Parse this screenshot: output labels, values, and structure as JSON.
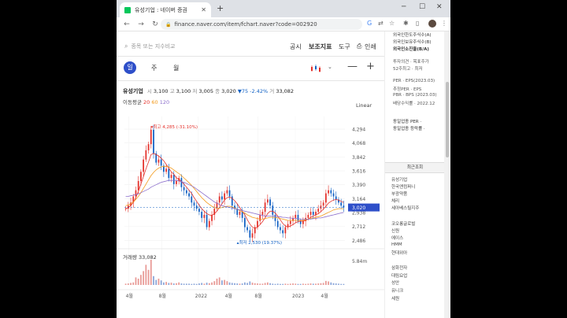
{
  "browser": {
    "tab_title": "유성기업 : 네이버 증권",
    "url": "finance.naver.com/item/fchart.naver?code=002920"
  },
  "toolbar": {
    "search_placeholder": "종목 또는 지수비교",
    "menu": [
      "공시",
      "보조지표",
      "도구",
      "인쇄"
    ]
  },
  "period_tabs": [
    "일",
    "주",
    "월"
  ],
  "quote": {
    "name": "유성기업",
    "open_label": "시",
    "open": "3,100",
    "high_label": "고",
    "high": "3,100",
    "low_label": "저",
    "low": "3,005",
    "close_label": "종",
    "close": "3,020",
    "change": "▼75 -2.42%",
    "volume_label": "거",
    "volume": "33,082"
  },
  "moving_avg": {
    "label": "이동평균",
    "periods": [
      "20",
      "60",
      "120"
    ],
    "colors": [
      "#e4312b",
      "#f39a1a",
      "#8c6fcc"
    ]
  },
  "scale_select": "Linear",
  "volume_panel": {
    "label": "거래량",
    "value": "33,082",
    "max_label": "5.84m"
  },
  "chart_data": {
    "type": "candlestick",
    "y_ticks": [
      4294,
      4068,
      3842,
      3616,
      3390,
      3164,
      2938,
      2712,
      2486
    ],
    "y_tick_labels": [
      "4,294",
      "4,068",
      "3,842",
      "3,616",
      "3,390",
      "3,164",
      "2,938",
      "2,712",
      "2,486"
    ],
    "ylim": [
      2400,
      4500
    ],
    "x_labels": [
      "4월",
      "8월",
      "2022",
      "4월",
      "8월",
      "2023",
      "4월"
    ],
    "x_positions": [
      0.02,
      0.17,
      0.335,
      0.47,
      0.605,
      0.775,
      0.905
    ],
    "current_price": 3020,
    "current_price_label": "3,020",
    "max_annotation": "최고 4,285 (-31.10%)",
    "max_price": 4285,
    "max_pos_x": 0.12,
    "min_annotation": "최저 2,530 (19.37%)",
    "min_price": 2530,
    "min_pos_x": 0.545,
    "close_series": [
      3000,
      3050,
      3100,
      3200,
      3300,
      3450,
      3600,
      3800,
      3950,
      4050,
      4285,
      3900,
      3750,
      3800,
      3700,
      3600,
      3650,
      3500,
      3550,
      3400,
      3450,
      3500,
      3350,
      3300,
      3250,
      3200,
      3100,
      3050,
      3000,
      2950,
      2850,
      2900,
      2700,
      2800,
      2900,
      3000,
      3100,
      3200,
      3150,
      3250,
      3300,
      3200,
      3050,
      3000,
      2900,
      2950,
      2850,
      2700,
      2650,
      2530,
      2600,
      2700,
      2800,
      2900,
      2950,
      3100,
      3150,
      3050,
      2900,
      2800,
      2700,
      2650,
      2600,
      2700,
      2750,
      2800,
      2850,
      2900,
      2800,
      2750,
      2800,
      2850,
      2900,
      2950,
      2900,
      2950,
      3000,
      3050,
      3100,
      3250,
      3300,
      3250,
      3200,
      3150,
      3100,
      3050,
      3020
    ],
    "ma20": [
      3000,
      3020,
      3050,
      3100,
      3180,
      3280,
      3400,
      3520,
      3650,
      3760,
      3880,
      3900,
      3880,
      3860,
      3820,
      3780,
      3720,
      3660,
      3600,
      3560,
      3500,
      3480,
      3440,
      3400,
      3350,
      3300,
      3250,
      3180,
      3120,
      3060,
      3000,
      2960,
      2920,
      2900,
      2890,
      2920,
      2960,
      3020,
      3080,
      3140,
      3180,
      3190,
      3170,
      3130,
      3080,
      3020,
      2960,
      2900,
      2820,
      2750,
      2700,
      2680,
      2700,
      2740,
      2790,
      2850,
      2920,
      2960,
      2960,
      2930,
      2880,
      2820,
      2760,
      2720,
      2700,
      2720,
      2740,
      2770,
      2790,
      2800,
      2800,
      2810,
      2830,
      2860,
      2880,
      2900,
      2920,
      2950,
      2990,
      3040,
      3090,
      3120,
      3140,
      3150,
      3140,
      3120,
      3100
    ],
    "ma60": [
      3050,
      3060,
      3080,
      3110,
      3150,
      3200,
      3260,
      3330,
      3400,
      3470,
      3540,
      3590,
      3630,
      3660,
      3680,
      3690,
      3690,
      3680,
      3660,
      3630,
      3600,
      3570,
      3540,
      3500,
      3460,
      3420,
      3380,
      3330,
      3280,
      3230,
      3180,
      3140,
      3100,
      3070,
      3040,
      3020,
      3010,
      3010,
      3020,
      3030,
      3040,
      3040,
      3030,
      3010,
      2990,
      2970,
      2950,
      2930,
      2900,
      2880,
      2860,
      2850,
      2840,
      2830,
      2830,
      2840,
      2850,
      2860,
      2860,
      2860,
      2850,
      2840,
      2830,
      2820,
      2810,
      2810,
      2810,
      2810,
      2810,
      2810,
      2810,
      2820,
      2830,
      2840,
      2850,
      2860,
      2870,
      2880,
      2900,
      2920,
      2940,
      2960,
      2980,
      2990,
      3000,
      3000,
      3000
    ],
    "ma120": [
      3200,
      3200,
      3210,
      3220,
      3230,
      3240,
      3260,
      3280,
      3300,
      3320,
      3350,
      3370,
      3390,
      3410,
      3430,
      3440,
      3450,
      3460,
      3460,
      3460,
      3460,
      3450,
      3440,
      3430,
      3410,
      3390,
      3370,
      3350,
      3320,
      3290,
      3260,
      3230,
      3200,
      3170,
      3140,
      3110,
      3090,
      3070,
      3050,
      3040,
      3030,
      3020,
      3010,
      3000,
      2990,
      2980,
      2970,
      2960,
      2950,
      2940,
      2930,
      2920,
      2910,
      2900,
      2890,
      2880,
      2880,
      2880,
      2880,
      2880,
      2870,
      2870,
      2860,
      2860,
      2850,
      2850,
      2840,
      2840,
      2840,
      2830,
      2830,
      2830,
      2830,
      2830,
      2840,
      2840,
      2850,
      2850,
      2860,
      2870,
      2880,
      2890,
      2900,
      2910,
      2920,
      2930,
      2940
    ],
    "volume_series": [
      0.05,
      0.06,
      0.08,
      0.1,
      0.3,
      0.25,
      0.4,
      0.55,
      0.8,
      0.6,
      1.0,
      0.35,
      0.2,
      0.25,
      0.18,
      0.1,
      0.12,
      0.08,
      0.09,
      0.06,
      0.07,
      0.1,
      0.06,
      0.05,
      0.05,
      0.05,
      0.04,
      0.05,
      0.04,
      0.06,
      0.08,
      0.05,
      0.09,
      0.07,
      0.1,
      0.15,
      0.25,
      0.3,
      0.18,
      0.2,
      0.15,
      0.1,
      0.08,
      0.07,
      0.06,
      0.05,
      0.06,
      0.1,
      0.08,
      0.14,
      0.09,
      0.07,
      0.06,
      0.05,
      0.05,
      0.08,
      0.1,
      0.07,
      0.05,
      0.04,
      0.05,
      0.04,
      0.04,
      0.05,
      0.04,
      0.05,
      0.06,
      0.05,
      0.04,
      0.04,
      0.05,
      0.04,
      0.05,
      0.06,
      0.05,
      0.05,
      0.06,
      0.07,
      0.08,
      0.16,
      0.14,
      0.1,
      0.07,
      0.06,
      0.05,
      0.04,
      0.04
    ]
  },
  "sidebar": {
    "top_items": [
      "외국인한도주식수(A)",
      "외국인보유주식수(B)",
      "외국인소진율(B/A)"
    ],
    "mid_items": [
      "투자의견 · 목표주가",
      "52주최고 · 최저"
    ],
    "per_items": [
      "PER · EPS(2023.03)",
      "추정PER · EPS",
      "PBR · BPS (2023.03)",
      "배당수익률 · 2022.12"
    ],
    "industry_items": [
      "동일업종 PER ·",
      "동일업종 등락률 ·"
    ],
    "recent_header": "최근조회",
    "recent_items": [
      "유성기업",
      "한국앤컴퍼니",
      "부광약품",
      "체리",
      "세아베스틸지주",
      "코오롱글로벌",
      "신원",
      "에이스",
      "HMM",
      "현대위아",
      "삼화전자",
      "대림요업",
      "성안",
      "유니크",
      "세원"
    ]
  }
}
